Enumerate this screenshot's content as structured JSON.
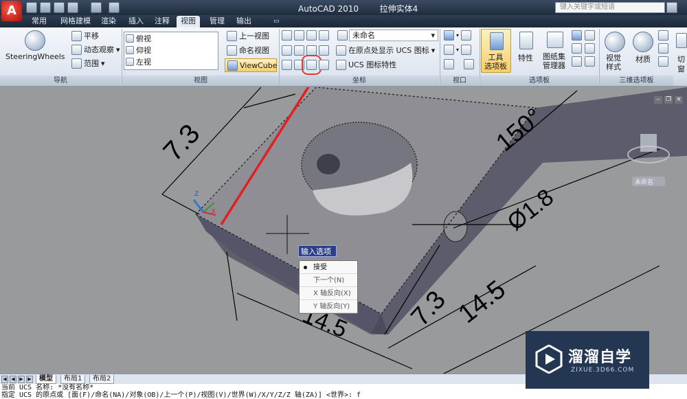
{
  "titlebar": {
    "app_logo": "A",
    "title": "AutoCAD 2010",
    "drawing": "拉伸实体4",
    "search_placeholder": "键入关键字或短语"
  },
  "ribbon_tabs": [
    "常用",
    "网格建模",
    "渲染",
    "插入",
    "注释",
    "视图",
    "管理",
    "输出"
  ],
  "active_tab": "视图",
  "navigation": {
    "steering_wheels": "SteeringWheels",
    "pan": "平移",
    "orbit": "动态观察",
    "extents": "范围",
    "panel_title": "导航"
  },
  "views": {
    "list": [
      "俯视",
      "仰视",
      "左视"
    ],
    "previous_view": "上一视图",
    "named_views": "命名视图",
    "viewcube": "ViewCube",
    "panel_title": "视图"
  },
  "ucs": {
    "unnamed": "未命名",
    "show_at_origin": "在原点处显示 UCS 图标",
    "ucs_icon_props": "UCS 图标特性",
    "panel_title": "坐标"
  },
  "viewports": {
    "panel_title": "视口"
  },
  "palettes": {
    "tool_palettes": "工具\n选项板",
    "properties": "特性",
    "sheet_set": "图纸集\n管理器",
    "panel_title": "选项板"
  },
  "palettes3d": {
    "visual_styles": "视觉\n样式",
    "materials": "材质",
    "panel_title": "三维选项板"
  },
  "drawing": {
    "dims": [
      "7.3",
      "150°",
      "Ø1.8",
      "7.3",
      "14.5",
      "14.5"
    ],
    "viewcube_label": "未命名",
    "axis_z": "Z",
    "axis_x": "X"
  },
  "input_options": {
    "title": "输入选项",
    "items": [
      "接受",
      "下一个(N)",
      "X 轴反向(X)",
      "Y 轴反向(Y)"
    ],
    "selected_index": 0
  },
  "layout_tabs": [
    "模型",
    "布局1",
    "布局2"
  ],
  "command_line": [
    "当前 UCS 名称: *没有名称*",
    "指定 UCS 的原点或 [面(F)/命名(NA)/对象(OB)/上一个(P)/视图(V)/世界(W)/X/Y/Z/Z 轴(ZA)] <世界>: f"
  ],
  "watermark": {
    "title": "溜溜自学",
    "url": "ZIXUE.3D66.COM"
  }
}
